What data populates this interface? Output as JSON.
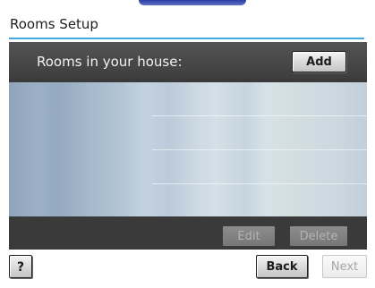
{
  "window": {
    "title": "Rooms Setup"
  },
  "rooms": {
    "header_label": "Rooms in your house:",
    "add_label": "Add",
    "items": [],
    "edit_label": "Edit",
    "delete_label": "Delete"
  },
  "nav": {
    "help_label": "?",
    "back_label": "Back",
    "next_label": "Next"
  },
  "colors": {
    "accent": "#3fa9e0",
    "panel": "#3a3a3a"
  }
}
